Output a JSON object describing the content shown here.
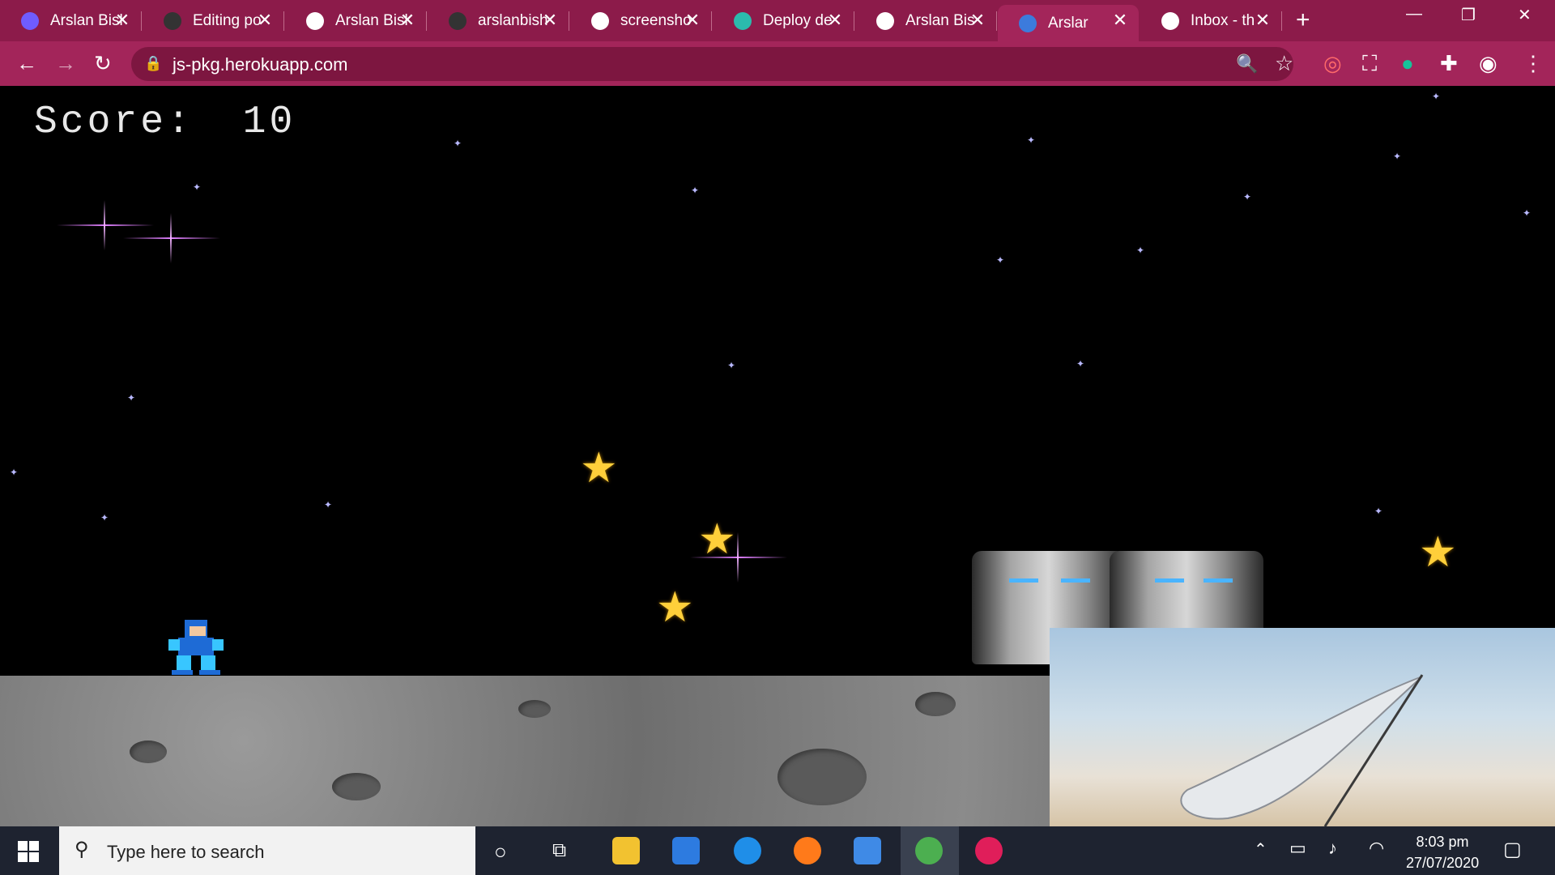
{
  "browser": {
    "tabs": [
      {
        "label": "Arslan Bisl",
        "icon": "meta-icon",
        "color": "#6f5cff",
        "close": "✕"
      },
      {
        "label": "Editing po",
        "icon": "github-icon",
        "color": "#333333",
        "close": "✕"
      },
      {
        "label": "Arslan Bisl",
        "icon": "globe-icon",
        "color": "#ffffff",
        "close": "✕"
      },
      {
        "label": "arslanbish",
        "icon": "github-icon",
        "color": "#333333",
        "close": "✕"
      },
      {
        "label": "screensho",
        "icon": "globe-icon",
        "color": "#ffffff",
        "close": "✕"
      },
      {
        "label": "Deploy de",
        "icon": "netlify-icon",
        "color": "#2bbbad",
        "close": "✕"
      },
      {
        "label": "Arslan Bis",
        "icon": "globe-icon",
        "color": "#ffffff",
        "close": "✕"
      },
      {
        "label": "Arslar",
        "icon": "ie-icon",
        "color": "#3c7bdc",
        "close": "✕",
        "active": true
      },
      {
        "label": "Inbox - th",
        "icon": "gmail-icon",
        "color": "#ffffff",
        "close": "✕"
      }
    ],
    "new_tab": "+",
    "window_controls": [
      "—",
      "❐",
      "✕"
    ],
    "url": "js-pkg.herokuapp.com"
  },
  "game": {
    "score_label": "Score:",
    "score_value": "10"
  },
  "taskbar": {
    "search_placeholder": "Type here to search",
    "time": "8:03 pm",
    "date": "27/07/2020"
  }
}
